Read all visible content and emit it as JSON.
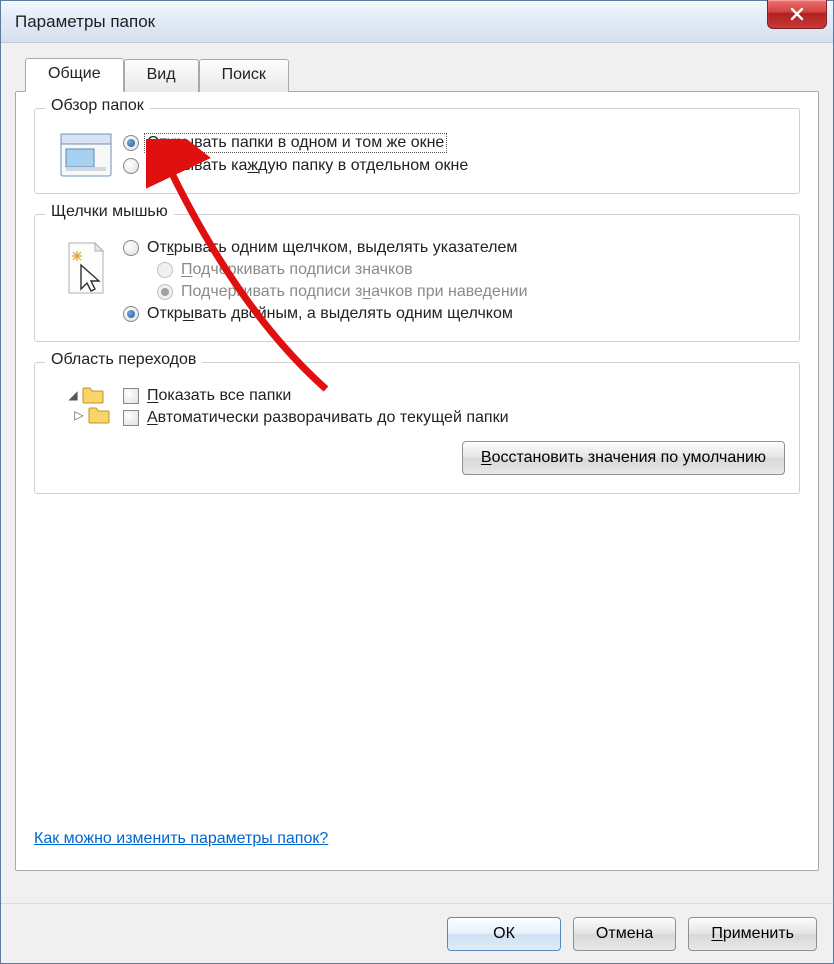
{
  "window": {
    "title": "Параметры папок",
    "close_name": "close"
  },
  "tabs": {
    "general": "Общие",
    "view": "Вид",
    "search": "Поиск"
  },
  "group_browse": {
    "title": "Обзор папок",
    "opt_same": "Открывать папки в одном и том же окне",
    "opt_new": "Открывать каждую папку в отдельном окне"
  },
  "group_click": {
    "title": "Щелчки мышью",
    "opt_single": "Открывать одним щелчком, выделять указателем",
    "sub_underline_always": "Подчеркивать подписи значков",
    "sub_underline_hover": "Подчеркивать подписи значков при наведении",
    "opt_double": "Открывать двойным, а выделять одним щелчком"
  },
  "group_nav": {
    "title": "Область переходов",
    "chk_show_all": "Показать все папки",
    "chk_auto_expand": "Автоматически разворачивать до текущей папки"
  },
  "restore_btn": "Восстановить значения по умолчанию",
  "help_link": "Как можно изменить параметры папок?",
  "buttons": {
    "ok": "ОК",
    "cancel": "Отмена",
    "apply": "Применить"
  }
}
